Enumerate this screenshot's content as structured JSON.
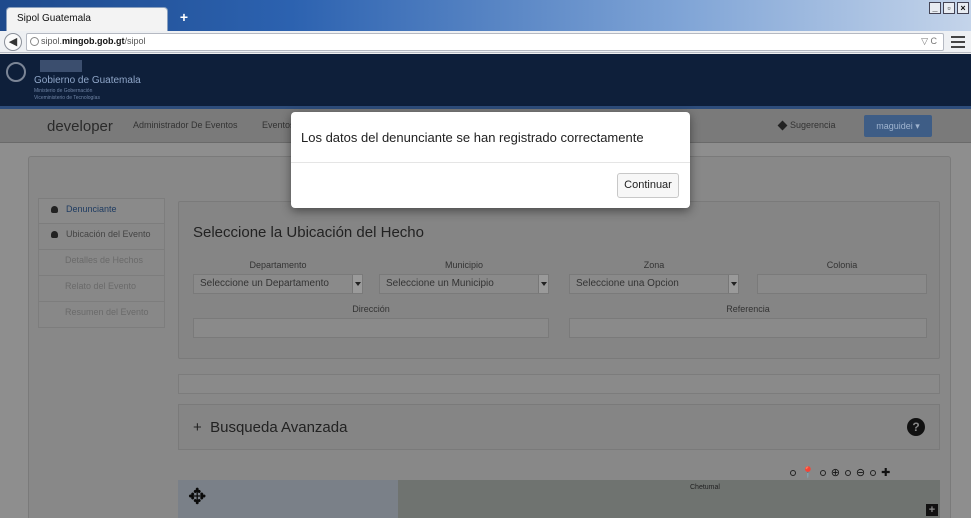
{
  "browser": {
    "tab_title": "Sipol Guatemala",
    "new_tab": "+",
    "window_buttons": [
      "_",
      "🗗",
      "×"
    ],
    "url_prefix": "sipol.",
    "url_domain": "mingob.gob.gt",
    "url_path": "/sipol",
    "url_right": "▽ C"
  },
  "brand": {
    "name": "Gobierno de Guatemala",
    "sub1": "Ministerio de Gobernación",
    "sub2": "Viceministerio de Tecnologías"
  },
  "appnav": {
    "title": "developer",
    "link1": "Administrador De Eventos",
    "link2": "Eventos",
    "suggestion": "Sugerencia",
    "user": "maguidei ▾"
  },
  "sidebar": {
    "items": [
      {
        "label": "Denunciante"
      },
      {
        "label": "Ubicación del Evento"
      },
      {
        "label": "Detalles de Hechos"
      },
      {
        "label": "Relato del Evento"
      },
      {
        "label": "Resumen del Evento"
      }
    ]
  },
  "location": {
    "heading": "Seleccione la Ubicación del Hecho",
    "departamento_label": "Departamento",
    "departamento_value": "Seleccione un Departamento",
    "municipio_label": "Municipio",
    "municipio_value": "Seleccione un Municipio",
    "zona_label": "Zona",
    "zona_value": "Seleccione una Opcion",
    "colonia_label": "Colonia",
    "direccion_label": "Dirección",
    "referencia_label": "Referencia"
  },
  "advanced": {
    "icon": "+",
    "title": "Busqueda Avanzada",
    "help": "?"
  },
  "map": {
    "city_label": "Chetumal"
  },
  "modal": {
    "message": "Los datos del denunciante se han registrado correctamente",
    "continue_label": "Continuar"
  }
}
